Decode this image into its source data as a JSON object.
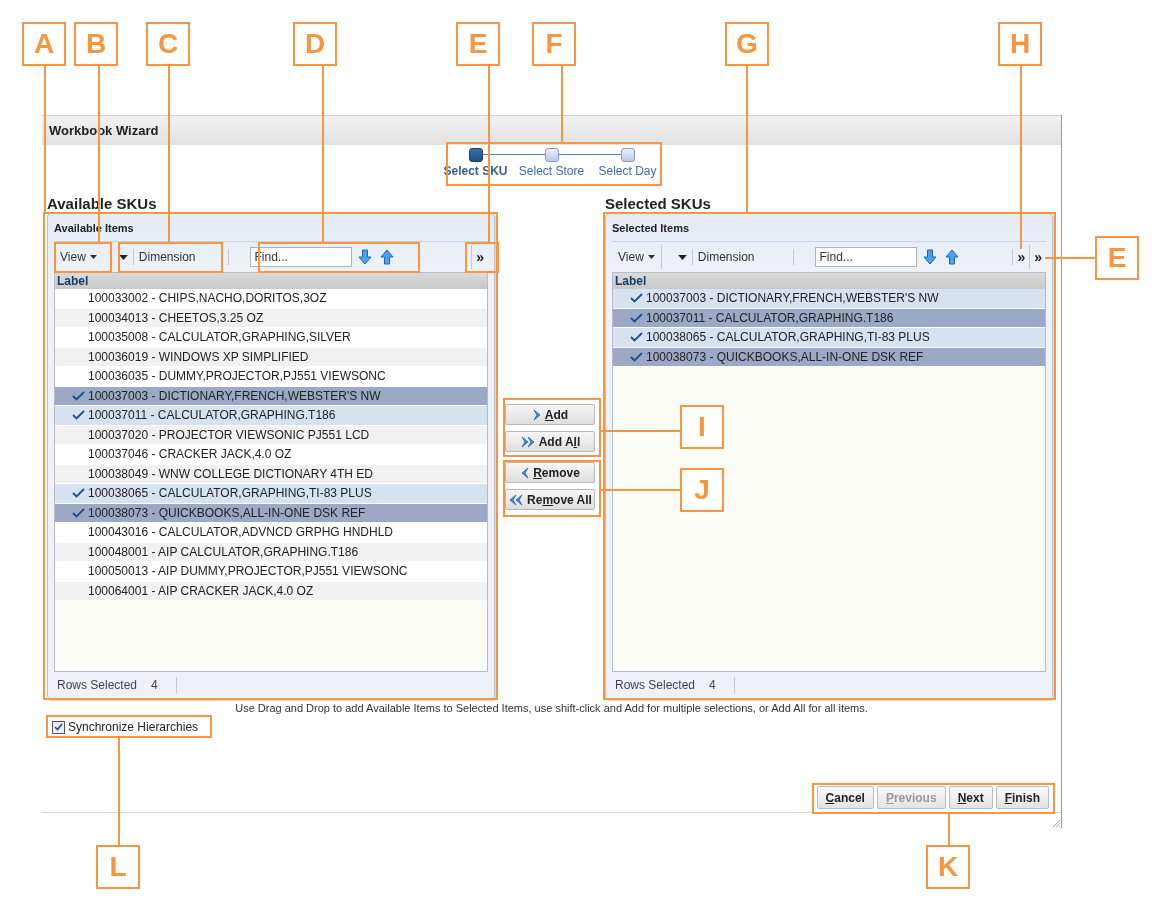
{
  "window": {
    "title": "Workbook Wizard"
  },
  "steps": [
    {
      "label": "Select SKU",
      "selected": true
    },
    {
      "label": "Select Store",
      "selected": false
    },
    {
      "label": "Select Day",
      "selected": false
    }
  ],
  "panels": [
    {
      "title": "Available SKUs",
      "header": "Available Items",
      "toolbar": {
        "view": "View",
        "dimension": "Dimension",
        "find_placeholder": "Find...",
        "overflow": [
          "»"
        ]
      },
      "column": "Label",
      "footer": {
        "label": "Rows Selected",
        "count": "4"
      },
      "rows": [
        {
          "text": "100033002 - CHIPS,NACHO,DORITOS,3OZ",
          "checked": false,
          "selected": false
        },
        {
          "text": "100034013 - CHEETOS,3.25 OZ",
          "checked": false,
          "selected": false
        },
        {
          "text": "100035008 - CALCULATOR,GRAPHING,SILVER",
          "checked": false,
          "selected": false
        },
        {
          "text": "100036019 - WINDOWS XP SIMPLIFIED",
          "checked": false,
          "selected": false
        },
        {
          "text": "100036035 - DUMMY,PROJECTOR,PJ551 VIEWSONC",
          "checked": false,
          "selected": false
        },
        {
          "text": "100037003 - DICTIONARY,FRENCH,WEBSTER'S NW",
          "checked": true,
          "selected": true
        },
        {
          "text": "100037011 - CALCULATOR,GRAPHING.T186",
          "checked": true,
          "selected": false
        },
        {
          "text": "100037020 - PROJECTOR VIEWSONIC PJ551 LCD",
          "checked": false,
          "selected": false
        },
        {
          "text": "100037046 - CRACKER JACK,4.0 OZ",
          "checked": false,
          "selected": false
        },
        {
          "text": "100038049 - WNW COLLEGE DICTIONARY 4TH ED",
          "checked": false,
          "selected": false
        },
        {
          "text": "100038065 - CALCULATOR,GRAPHING,TI-83 PLUS",
          "checked": true,
          "selected": false
        },
        {
          "text": "100038073 - QUICKBOOKS,ALL-IN-ONE DSK REF",
          "checked": true,
          "selected": true
        },
        {
          "text": "100043016 - CALCULATOR,ADVNCD GRPHG HNDHLD",
          "checked": false,
          "selected": false
        },
        {
          "text": "100048001 - AIP CALCULATOR,GRAPHING.T186",
          "checked": false,
          "selected": false
        },
        {
          "text": "100050013 - AIP DUMMY,PROJECTOR,PJ551 VIEWSONC",
          "checked": false,
          "selected": false
        },
        {
          "text": "100064001 - AIP CRACKER JACK,4.0 OZ",
          "checked": false,
          "selected": false
        }
      ]
    },
    {
      "title": "Selected SKUs",
      "header": "Selected Items",
      "toolbar": {
        "view": "View",
        "dimension": "Dimension",
        "find_placeholder": "Find...",
        "overflow": [
          "»",
          "»"
        ]
      },
      "column": "Label",
      "footer": {
        "label": "Rows Selected",
        "count": "4"
      },
      "rows": [
        {
          "text": "100037003 - DICTIONARY,FRENCH,WEBSTER'S NW",
          "checked": true,
          "selected": false
        },
        {
          "text": "100037011 - CALCULATOR,GRAPHING.T186",
          "checked": true,
          "selected": true
        },
        {
          "text": "100038065 - CALCULATOR,GRAPHING,TI-83 PLUS",
          "checked": true,
          "selected": false
        },
        {
          "text": "100038073 - QUICKBOOKS,ALL-IN-ONE DSK REF",
          "checked": true,
          "selected": true
        }
      ]
    }
  ],
  "transfer_buttons": [
    {
      "label_parts": {
        "key": "A",
        "after": "dd"
      },
      "kind": "add"
    },
    {
      "label_parts": {
        "before": "Add A",
        "key": "l",
        "after": "l"
      },
      "kind": "add_all"
    },
    {
      "label_parts": {
        "key": "R",
        "after": "emove"
      },
      "kind": "remove"
    },
    {
      "label_parts": {
        "before": "Re",
        "key": "m",
        "after": "ove All"
      },
      "kind": "remove_all"
    }
  ],
  "hint": "Use Drag and Drop to add Available Items to Selected Items, use shift-click and Add for multiple selections, or Add All for all items.",
  "synchronize": {
    "label": "Synchronize Hierarchies",
    "checked": true
  },
  "footer_buttons": [
    {
      "label_parts": {
        "key": "C",
        "after": "ancel"
      },
      "disabled": false
    },
    {
      "label_parts": {
        "key": "P",
        "after": "revious"
      },
      "disabled": true
    },
    {
      "label_parts": {
        "key": "N",
        "after": "ext"
      },
      "disabled": false
    },
    {
      "label_parts": {
        "key": "F",
        "after": "inish"
      },
      "disabled": false
    }
  ],
  "callouts": [
    {
      "letter": "A"
    },
    {
      "letter": "B"
    },
    {
      "letter": "C"
    },
    {
      "letter": "D"
    },
    {
      "letter": "E"
    },
    {
      "letter": "F"
    },
    {
      "letter": "G"
    },
    {
      "letter": "H"
    },
    {
      "letter": "E"
    },
    {
      "letter": "I"
    },
    {
      "letter": "J"
    },
    {
      "letter": "L"
    },
    {
      "letter": "K"
    }
  ]
}
